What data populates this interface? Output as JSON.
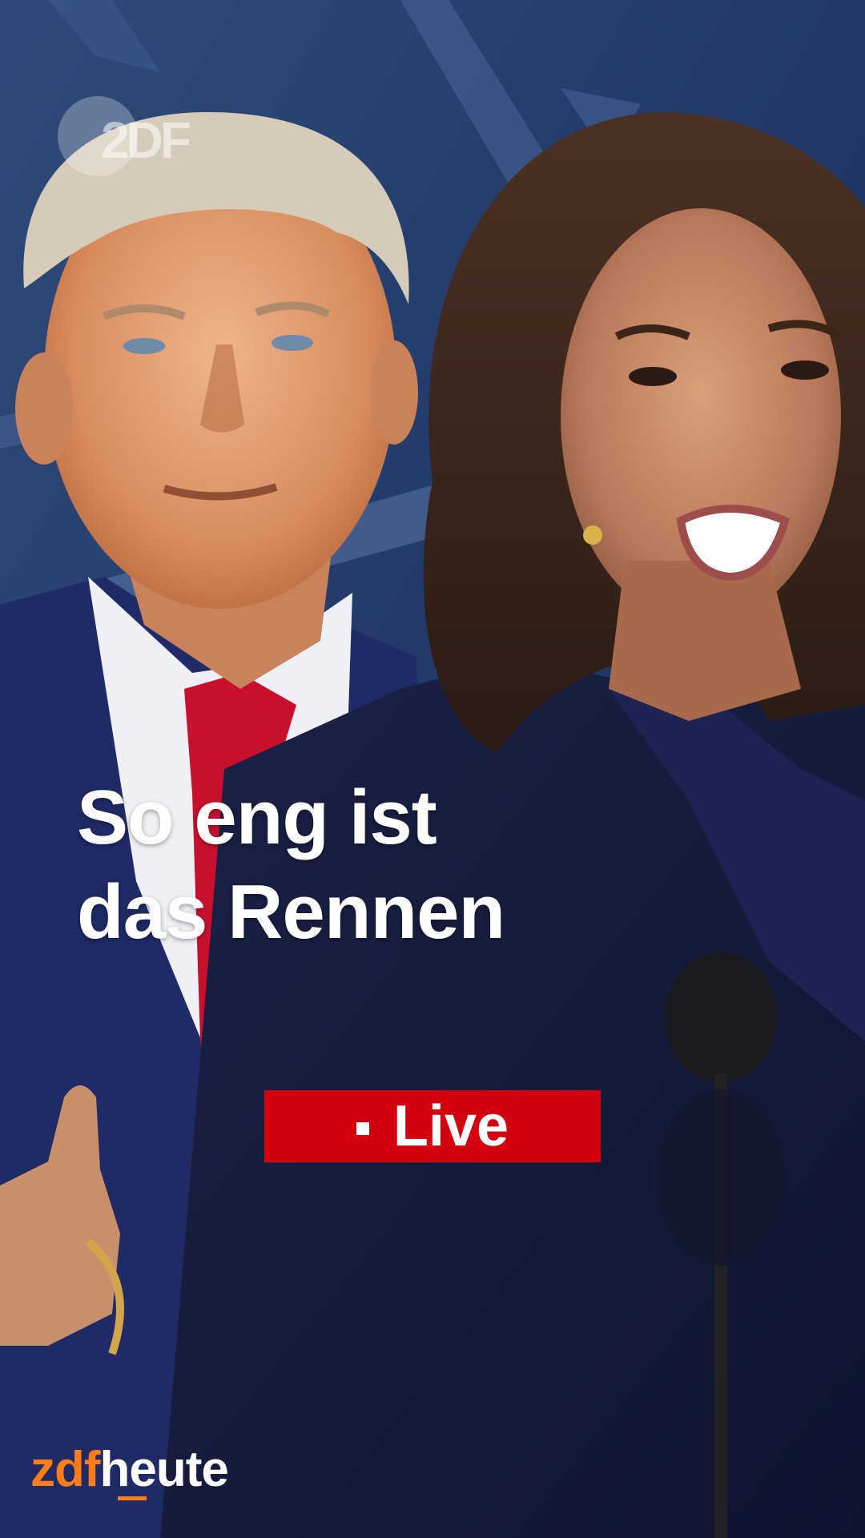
{
  "watermark": {
    "text": "2DF",
    "icon": "zdf-logo-watermark"
  },
  "headline": {
    "line1": "So eng ist",
    "line2": "das Rennen"
  },
  "live_badge": {
    "label": "Live",
    "color": "#d2000f"
  },
  "brand": {
    "zdf": "zdf",
    "heute": "heute",
    "accent": "#fa7d19"
  },
  "colors": {
    "background": "#1b2a4e",
    "suit": "#141b36",
    "tie": "#c8102e"
  }
}
